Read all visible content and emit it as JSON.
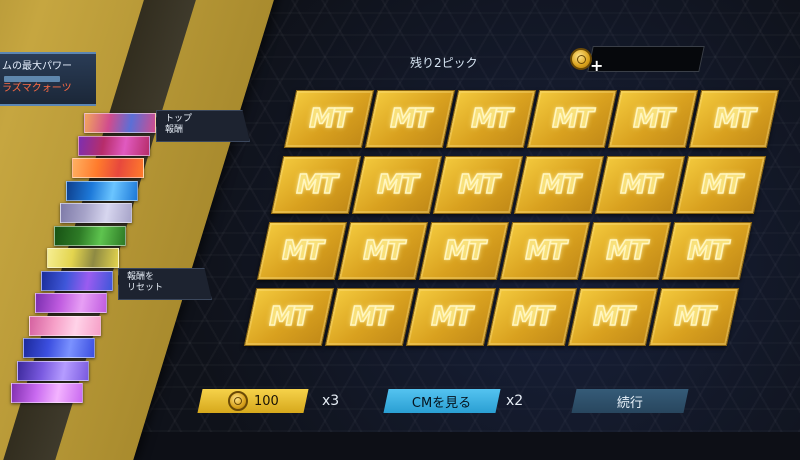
{
  "header": {
    "picks_left": "残り2ピック"
  },
  "info_panel": {
    "line1": "ムの最大パワー",
    "line2": "ラズマクォーツ"
  },
  "tooltips": {
    "top_reward": "トップ\n報酬",
    "reset_reward": "報酬を\nリセット"
  },
  "reward_strips": [
    {
      "colors": [
        "#d04c8e",
        "#5b6fd6",
        "#f2a65e"
      ]
    },
    {
      "colors": [
        "#b72d6a",
        "#e05ac0",
        "#7d2fb0"
      ]
    },
    {
      "colors": [
        "#ff7b2c",
        "#e7483d",
        "#ffb061"
      ]
    },
    {
      "colors": [
        "#1d79d9",
        "#6bc5ff",
        "#0e3f8c"
      ]
    },
    {
      "colors": [
        "#a7a4c9",
        "#d7d6ef",
        "#7e7aa8"
      ]
    },
    {
      "colors": [
        "#2d7a26",
        "#5ec44f",
        "#175214"
      ]
    },
    {
      "colors": [
        "#e3d44e",
        "#8e8a43",
        "#f6ee92"
      ]
    },
    {
      "colors": [
        "#3f57d9",
        "#9a5cf0",
        "#1b2e9b"
      ]
    },
    {
      "colors": [
        "#c05ce0",
        "#e79ff5",
        "#7b2fb0"
      ]
    },
    {
      "colors": [
        "#f6a0c8",
        "#ffd3e8",
        "#d562a1"
      ]
    },
    {
      "colors": [
        "#3c4fe0",
        "#7b92ff",
        "#1c2a9c"
      ]
    },
    {
      "colors": [
        "#7a5ae0",
        "#b59cff",
        "#3d2a9c"
      ]
    },
    {
      "colors": [
        "#c96af0",
        "#f3b3ff",
        "#8230b0"
      ]
    }
  ],
  "cards": {
    "rows": 4,
    "cols": 6,
    "label": "MT"
  },
  "footer": {
    "coin_cost": "100",
    "coin_mult": "x3",
    "ad_label": "CMを見る",
    "ad_mult": "x2",
    "continue_label": "続行"
  }
}
